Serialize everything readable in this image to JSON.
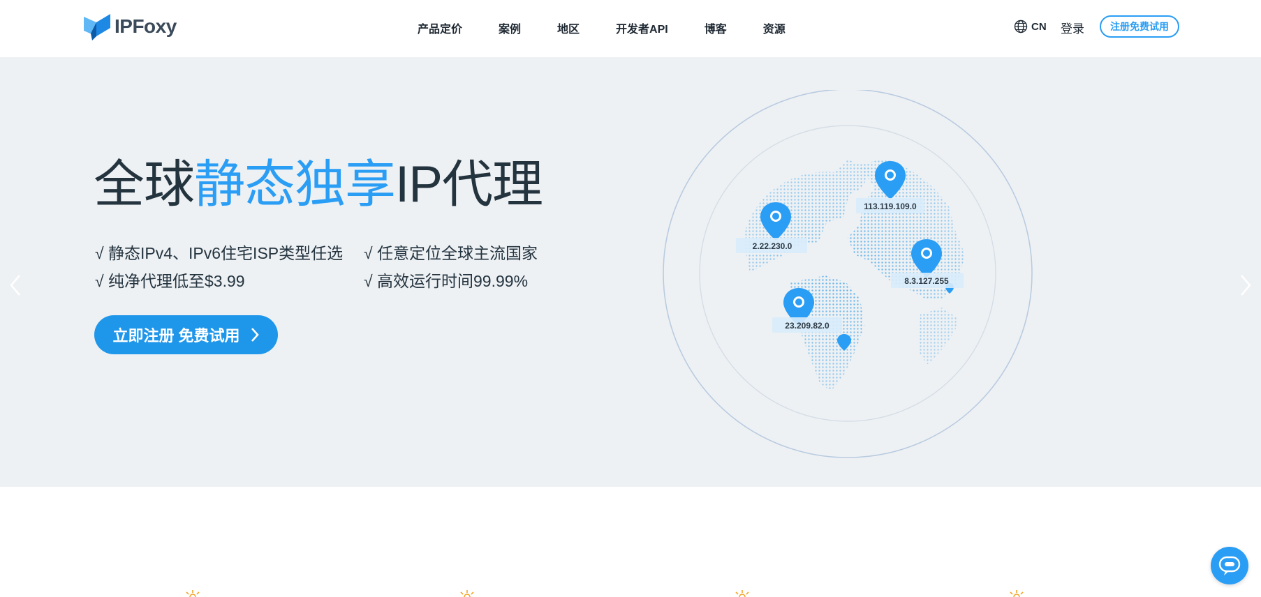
{
  "brand": {
    "name": "IPFoxy"
  },
  "nav": {
    "items": [
      {
        "label": "产品定价"
      },
      {
        "label": "案例"
      },
      {
        "label": "地区"
      },
      {
        "label": "开发者API"
      },
      {
        "label": "博客"
      },
      {
        "label": "资源"
      }
    ]
  },
  "header": {
    "lang": "CN",
    "login": "登录",
    "signup": "注册免费试用"
  },
  "hero": {
    "title_part1": "全球",
    "title_highlight": "静态独享",
    "title_part2": "IP代理",
    "features": [
      "√ 静态IPv4、IPv6住宅ISP类型任选",
      "√ 任意定位全球主流国家",
      "√ 纯净代理低至$3.99",
      "√ 高效运行时间99.99%"
    ],
    "cta": "立即注册 免费试用"
  },
  "globe": {
    "ip_labels": [
      "113.119.109.0",
      "2.22.230.0",
      "8.3.127.255",
      "23.209.82.0"
    ]
  },
  "colors": {
    "accent": "#2a9df4",
    "hero_bg": "#eef1f4",
    "text_dark": "#24343f"
  },
  "icons": [
    "globe-language-icon",
    "chevron-left-icon",
    "chevron-right-icon",
    "chat-icon",
    "sun-icon",
    "location-pin-icon"
  ]
}
